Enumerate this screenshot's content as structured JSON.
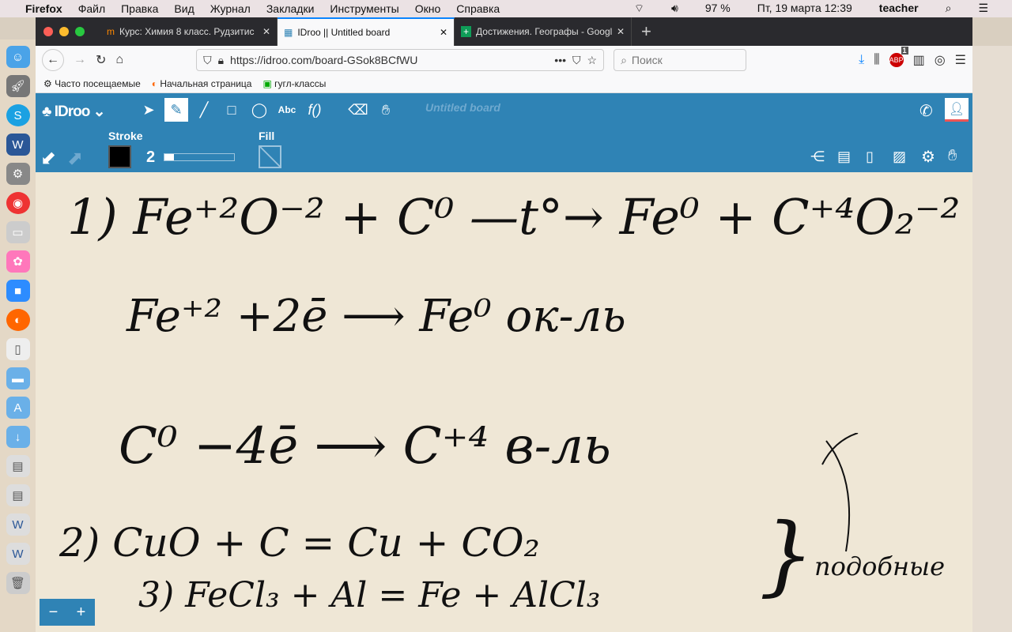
{
  "menubar": {
    "app": "Firefox",
    "items": [
      "Файл",
      "Правка",
      "Вид",
      "Журнал",
      "Закладки",
      "Инструменты",
      "Окно",
      "Справка"
    ],
    "battery": "97 %",
    "datetime": "Пт, 19 марта  12:39",
    "user": "teacher"
  },
  "tabs": [
    {
      "title": "Курс: Химия 8 класс. Рудзитис"
    },
    {
      "title": "IDroo || Untitled board"
    },
    {
      "title": "Достижения. Географы - Google"
    }
  ],
  "nav": {
    "url": "https://idroo.com/board-GSok8BCfWU",
    "search_placeholder": "Поиск",
    "badge": "1"
  },
  "bookmarks": [
    "Часто посещаемые",
    "Начальная страница",
    "гугл-классы"
  ],
  "idroo": {
    "logo": "IDroo",
    "board_title": "Untitled board",
    "stroke_label": "Stroke",
    "stroke_width": "2",
    "fill_label": "Fill",
    "stroke_color": "#000000",
    "tools": [
      "select",
      "pencil",
      "line",
      "rectangle",
      "ellipse",
      "Abc",
      "f()",
      "eraser",
      "hand"
    ]
  },
  "board": {
    "lines": [
      "1)  Fe⁺²O⁻² + C⁰ —t°→ Fe⁰ + C⁺⁴O₂⁻²",
      "Fe⁺² +2ē ⟶ Fe⁰   ок-ль",
      "C⁰ −4ē ⟶ C⁺⁴   в-ль",
      "2)  CuO + C = Cu + CO₂",
      "3)  FeCl₃ + Al = Fe + AlCl₃"
    ],
    "note": "подобные"
  },
  "zoom": {
    "minus": "−",
    "plus": "+"
  }
}
